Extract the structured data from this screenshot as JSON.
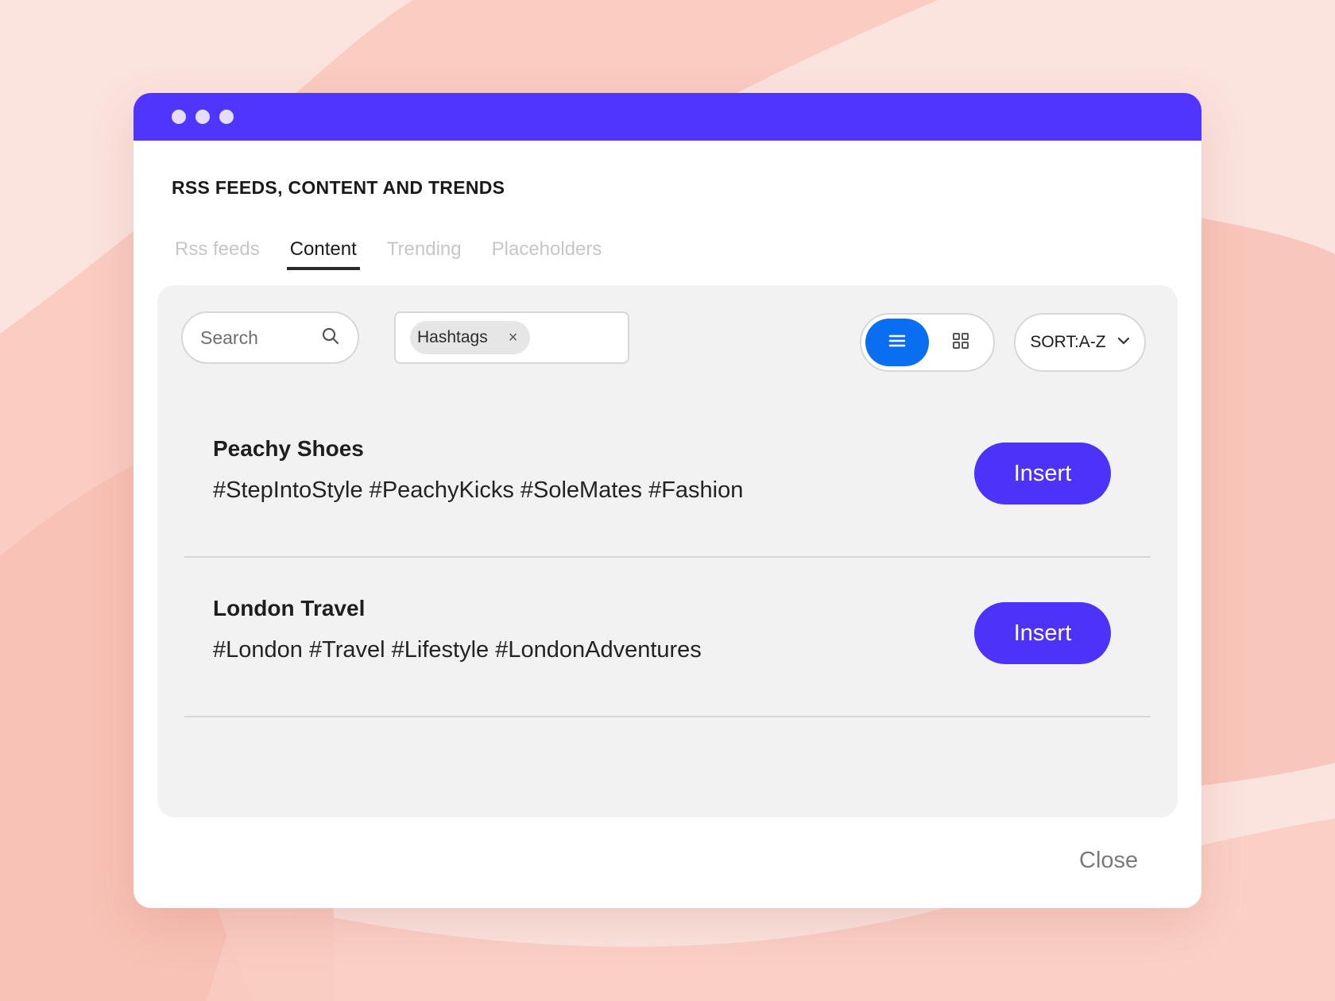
{
  "window": {
    "title": "RSS FEEDS, CONTENT AND TRENDS"
  },
  "tabs": [
    {
      "label": "Rss feeds",
      "active": false
    },
    {
      "label": "Content",
      "active": true
    },
    {
      "label": "Trending",
      "active": false
    },
    {
      "label": "Placeholders",
      "active": false
    }
  ],
  "toolbar": {
    "search_placeholder": "Search",
    "filter_chip": "Hashtags",
    "chip_remove": "×",
    "view_mode": "list",
    "sort_label": "SORT:A-Z"
  },
  "items": [
    {
      "title": "Peachy Shoes",
      "tags": "#StepIntoStyle #PeachyKicks #SoleMates #Fashion",
      "action": "Insert"
    },
    {
      "title": "London Travel",
      "tags": "#London #Travel #Lifestyle #LondonAdventures",
      "action": "Insert"
    }
  ],
  "footer": {
    "close_label": "Close"
  },
  "colors": {
    "titlebar": "#5035ff",
    "insert_button": "#4c33f7",
    "view_active": "#0a6ef0",
    "background": "#fbe3de"
  },
  "icons": {
    "search": "search-icon",
    "list_view": "list-view-icon",
    "grid_view": "grid-view-icon",
    "sort_chevron": "chevron-down-icon"
  }
}
